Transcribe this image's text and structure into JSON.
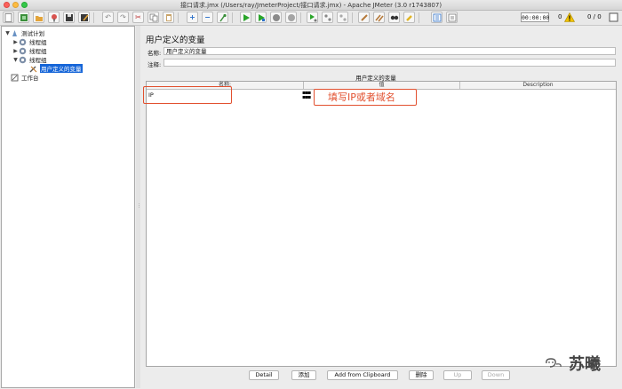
{
  "window": {
    "title": "接口请求.jmx (/Users/ray/JmeterProject/接口请求.jmx) - Apache JMeter (3.0 r1743807)"
  },
  "toolbar": {
    "timer": "00:00:00",
    "errors": "0",
    "threads": "0 / 0"
  },
  "tree": {
    "root": "测试计划",
    "groups": [
      "线程组",
      "线程组",
      "线程组"
    ],
    "selected": "用户定义的变量",
    "workbench": "工作台"
  },
  "panel": {
    "title": "用户定义的变量",
    "name_label": "名称:",
    "name_value": "用户定义的变量",
    "comment_label": "注释:",
    "comment_value": "",
    "table_caption": "用户定义的变量",
    "columns": [
      "名称:",
      "值",
      "Description"
    ],
    "rows": [
      {
        "name": "IP",
        "value": "",
        "description": ""
      }
    ]
  },
  "annotation": {
    "text": "填写IP或者域名",
    "color": "#e2502f"
  },
  "buttons": {
    "detail": "Detail",
    "add": "添加",
    "add_clipboard": "Add from Clipboard",
    "delete": "删除",
    "up": "Up",
    "down": "Down"
  },
  "watermark": {
    "text": "苏曦"
  }
}
